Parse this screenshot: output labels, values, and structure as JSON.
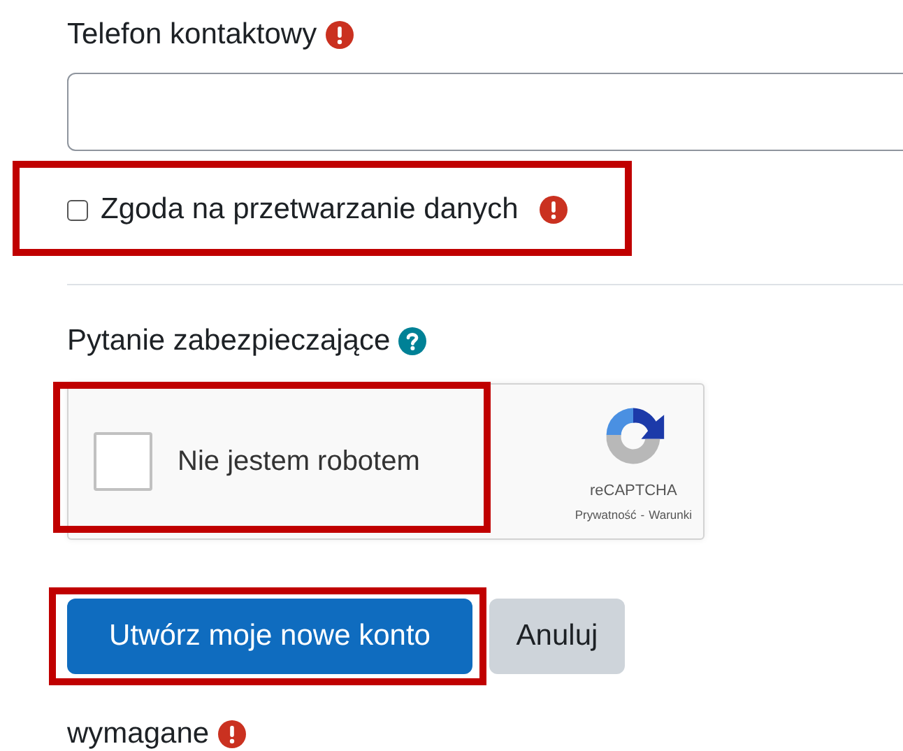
{
  "phone_field": {
    "label": "Telefon kontaktowy",
    "required": true
  },
  "consent": {
    "label": "Zgoda na przetwarzanie danych",
    "checked": false,
    "required": true,
    "highlighted": true
  },
  "security_question": {
    "label": "Pytanie zabezpieczające",
    "help": true,
    "captcha": {
      "label": "Nie jestem robotem",
      "checked": false,
      "highlighted": true,
      "brand": "reCAPTCHA",
      "links": [
        "Prywatność",
        "Warunki"
      ],
      "separator": "-"
    }
  },
  "buttons": [
    {
      "label": "Utwórz moje nowe konto",
      "kind": "primary",
      "highlighted": true
    },
    {
      "label": "Anuluj",
      "kind": "secondary",
      "highlighted": false
    }
  ],
  "required_note": {
    "label": "wymagane",
    "required": true
  }
}
